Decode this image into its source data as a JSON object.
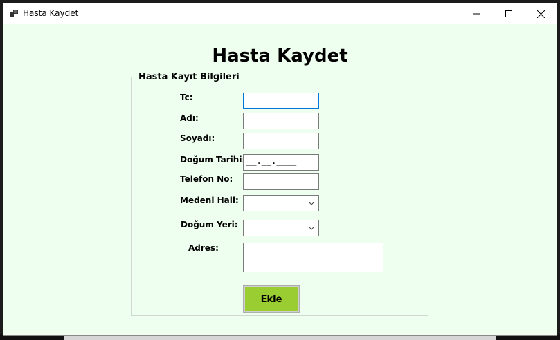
{
  "window": {
    "title": "Hasta Kaydet"
  },
  "form": {
    "heading": "Hasta Kaydet",
    "group_title": "Hasta Kayıt Bilgileri",
    "labels": {
      "tc": "Tc:",
      "adi": "Adı:",
      "soyadi": "Soyadı:",
      "dogum_tarihi": "Doğum Tarihi:",
      "telefon": "Telefon No:",
      "medeni_hali": "Medeni Hali:",
      "dogum_yeri": "Doğum Yeri:",
      "adres": "Adres:"
    },
    "masks": {
      "tc": "_________",
      "dogum_tarihi": "__.__.____",
      "telefon": "_______"
    },
    "submit_label": "Ekle"
  },
  "colors": {
    "background": "#efffef",
    "button": "#9acd32",
    "focus_border": "#0078d7"
  },
  "icons": [
    "app-icon",
    "minimize-icon",
    "maximize-icon",
    "close-icon",
    "chevron-down-icon",
    "resize-grip-icon"
  ]
}
